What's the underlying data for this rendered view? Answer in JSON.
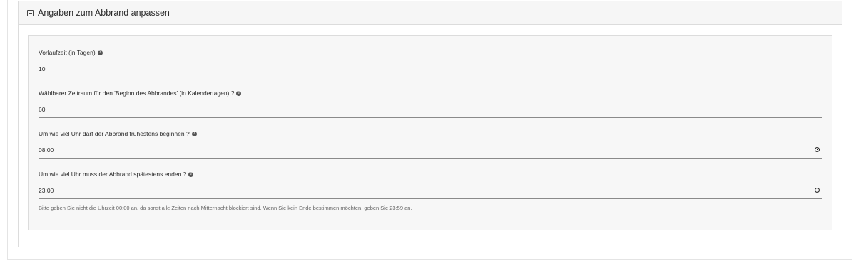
{
  "panel": {
    "title": "Angaben zum Abbrand anpassen"
  },
  "fields": [
    {
      "label": "Vorlaufzeit (in Tagen)",
      "value": "10"
    },
    {
      "label": "Wählbarer Zeitraum für den 'Beginn des Abbrandes' (in Kalendertagen) ?",
      "value": "60"
    },
    {
      "label": "Um wie viel Uhr darf der Abbrand frühestens beginnen ?",
      "value": "08:00"
    },
    {
      "label": "Um wie viel Uhr muss der Abbrand spätestens enden ?",
      "value": "23:00"
    }
  ],
  "hint": "Bitte geben Sie nicht die Uhrzeit 00:00 an, da sonst alle Zeiten nach Mitternacht blockiert sind. Wenn Sie kein Ende bestimmen möchten, geben Sie 23:59 an.",
  "icons": {
    "help": "?",
    "collapse": "minus-square-icon",
    "time": "clock-icon"
  }
}
